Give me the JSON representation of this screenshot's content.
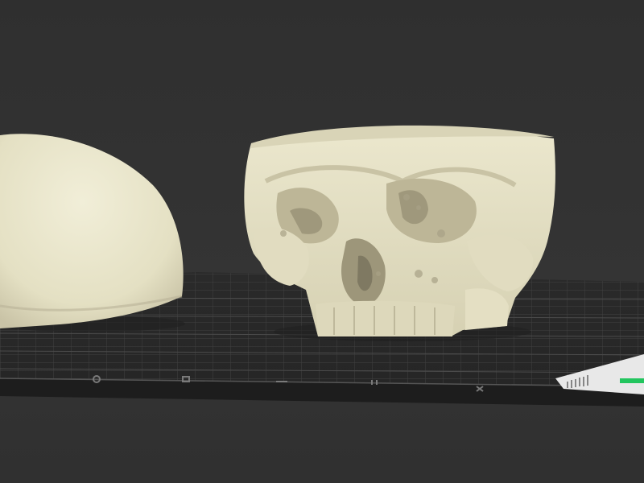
{
  "app": {
    "view": "3d-slicer-build-plate"
  },
  "colors": {
    "background": "#323232",
    "plate_surface": "#2c2c2c",
    "plate_grid_minor": "#3a3a3a",
    "plate_grid_major": "#4a4a4a",
    "plate_edge": "#1f1f1f",
    "model": "#e6e2c6",
    "model_shadow": "#b7b196",
    "accent": "#22c55e"
  },
  "plate_icons": [
    {
      "icon": "circle-icon"
    },
    {
      "icon": "square-icon"
    },
    {
      "icon": "line-icon"
    },
    {
      "icon": "double-bar-icon"
    },
    {
      "icon": "cross-icon"
    }
  ],
  "models": [
    {
      "name": "skull-cap"
    },
    {
      "name": "skull-face"
    }
  ]
}
